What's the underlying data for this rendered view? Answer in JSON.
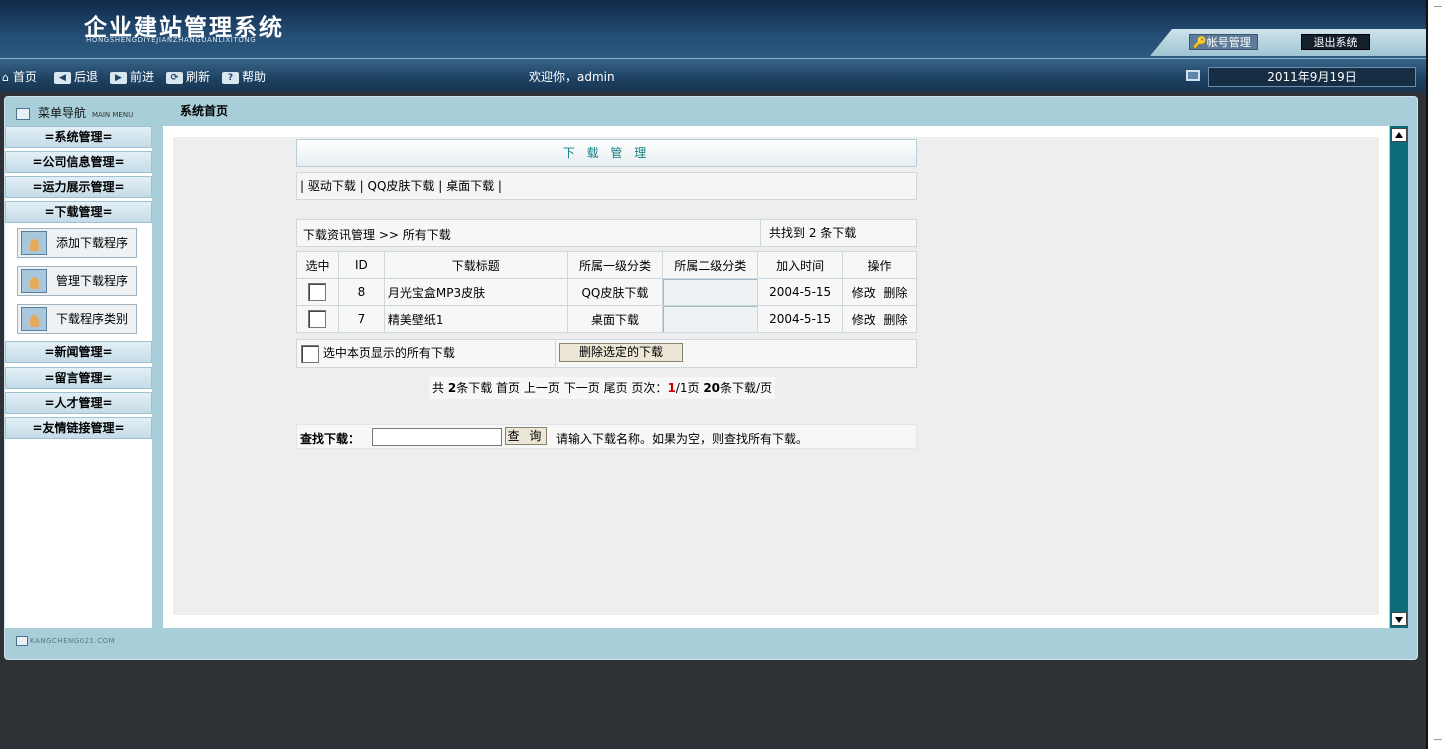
{
  "header": {
    "logo_cn": "企业建站管理系统",
    "logo_en": "HONGSHENGDIYEJIANZHANGUANLIXITONG",
    "account_button": "帐号管理",
    "logout_button": "退出系统"
  },
  "toolbar": {
    "home": "首页",
    "back": "后退",
    "forward": "前进",
    "refresh": "刷新",
    "help": "帮助",
    "welcome": "欢迎你，admin",
    "date": "2011年9月19日"
  },
  "sidebar": {
    "title": "菜单导航",
    "title_en": "MAIN MENU",
    "menu": [
      "=系统管理=",
      "=公司信息管理=",
      "=运力展示管理=",
      "=下载管理=",
      "=新闻管理=",
      "=留言管理=",
      "=人才管理=",
      "=友情链接管理="
    ],
    "submenu": [
      "添加下载程序",
      "管理下载程序",
      "下载程序类别"
    ],
    "footer": "KANGCHENG021.COM"
  },
  "main": {
    "breadcrumb": "系统首页",
    "panel_title": "下 载 管 理",
    "categories": "| 驱动下载 | QQ皮肤下载 | 桌面下载 |",
    "info_left": "下载资讯管理  >> 所有下载",
    "info_right": "共找到 2 条下载",
    "table": {
      "headers": [
        "选中",
        "ID",
        "下载标题",
        "所属一级分类",
        "所属二级分类",
        "加入时间",
        "操作"
      ],
      "rows": [
        {
          "id": "8",
          "title": "月光宝盒MP3皮肤",
          "cat1": "QQ皮肤下载",
          "cat2": "",
          "date": "2004-5-15",
          "edit": "修改",
          "delete": "删除"
        },
        {
          "id": "7",
          "title": "精美壁纸1",
          "cat1": "桌面下载",
          "cat2": "",
          "date": "2004-5-15",
          "edit": "修改",
          "delete": "删除"
        }
      ]
    },
    "select_all_label": "选中本页显示的所有下载",
    "delete_selected_button": "删除选定的下载",
    "pager": {
      "total_prefix": "共",
      "total": "2",
      "total_suffix": "条下载",
      "first": "首页",
      "prev": "上一页",
      "next": "下一页",
      "last": "尾页",
      "page_label": "页次：",
      "current": "1",
      "pages": "/1页",
      "per_page": "20",
      "per_page_suffix": "条下载/页"
    },
    "search": {
      "label": "查找下载：",
      "value": "",
      "button": "查 询",
      "hint": "请输入下载名称。如果为空，则查找所有下载。"
    }
  }
}
